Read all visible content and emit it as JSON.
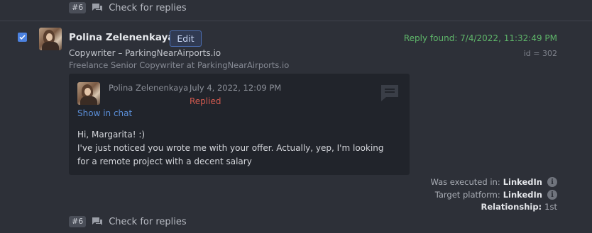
{
  "top_step": {
    "badge": "#6",
    "label": "Check for replies"
  },
  "item": {
    "checked": true,
    "name": "Polina Zelenenkaya",
    "edit_label": "Edit",
    "headline": "Copywriter – ParkingNearAirports.io",
    "position": "Freelance Senior Copywriter at ParkingNearAirports.io",
    "reply_found": "Reply found: 7/4/2022, 11:32:49 PM",
    "id_text": "id = 302"
  },
  "message": {
    "sender": "Polina Zelenenkaya",
    "date": "July 4, 2022, 12:09 PM",
    "status": "Replied",
    "show_in_chat": "Show in chat",
    "lines": [
      "Hi, Margarita! :)",
      "I've just noticed you wrote me with your offer. Actually, yep, I'm looking",
      "for a remote project with a decent salary"
    ],
    "icon": "comment-icon"
  },
  "meta": {
    "executed_label": "Was executed in:",
    "executed_value": "LinkedIn",
    "target_label": "Target platform:",
    "target_value": "LinkedIn",
    "relationship_label": "Relationship:",
    "relationship_value": "1st"
  },
  "bottom_step": {
    "badge": "#6",
    "label": "Check for replies"
  },
  "colors": {
    "background": "#2d3038",
    "card": "#21242b",
    "accent_blue": "#4c82e0",
    "reply_green": "#5fb76a",
    "replied_red": "#d35a4f"
  }
}
